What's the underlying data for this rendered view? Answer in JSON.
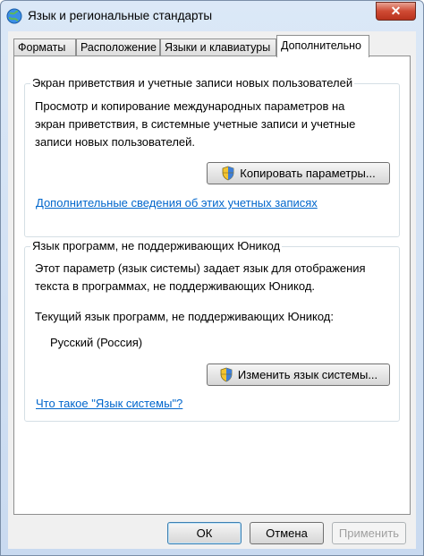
{
  "window": {
    "title": "Язык и региональные стандарты",
    "close_label": "✕"
  },
  "tabs": [
    {
      "label": "Форматы"
    },
    {
      "label": "Расположение"
    },
    {
      "label": "Языки и клавиатуры"
    },
    {
      "label": "Дополнительно",
      "active": true
    }
  ],
  "welcome_group": {
    "legend": "Экран приветствия и учетные записи новых пользователей",
    "description_line1": "Просмотр и копирование международных параметров на",
    "description_line2": "экран приветствия, в системные учетные записи и учетные",
    "description_line3": "записи новых пользователей.",
    "copy_button": "Копировать параметры...",
    "link": "Дополнительные сведения об этих учетных записях"
  },
  "non_unicode_group": {
    "legend": "Язык программ, не поддерживающих Юникод",
    "description_line1": "Этот параметр (язык системы) задает язык для отображения",
    "description_line2": "текста в программах, не поддерживающих Юникод.",
    "current_label": "Текущий язык программ, не поддерживающих Юникод:",
    "current_value": "Русский (Россия)",
    "change_button": "Изменить язык системы...",
    "link": "Что такое \"Язык системы\"?"
  },
  "footer": {
    "ok": "ОК",
    "cancel": "Отмена",
    "apply": "Применить"
  }
}
